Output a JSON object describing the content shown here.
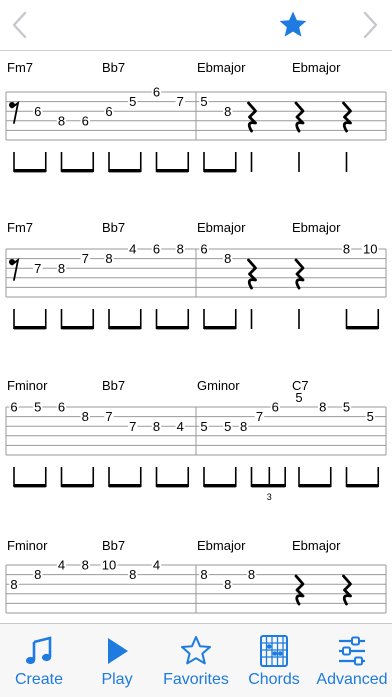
{
  "header": {
    "back_icon": "chevron-left-icon",
    "favorite_icon": "star-filled-icon",
    "forward_icon": "chevron-right-icon"
  },
  "colors": {
    "accent": "#1e7be0",
    "disabled": "#c7c7cc",
    "staff_line": "#9a9a9a"
  },
  "score": {
    "systems": [
      {
        "chords": [
          {
            "name": "Fm7",
            "beat": 0
          },
          {
            "name": "Bb7",
            "beat": 2
          },
          {
            "name": "Ebmajor",
            "beat": 4
          },
          {
            "name": "Ebmajor",
            "beat": 6
          }
        ],
        "notes": [
          {
            "beat": 0.5,
            "string": 2,
            "fret": "6"
          },
          {
            "beat": 1,
            "string": 3,
            "fret": "8"
          },
          {
            "beat": 1.5,
            "string": 3,
            "fret": "6"
          },
          {
            "beat": 2,
            "string": 2,
            "fret": "6"
          },
          {
            "beat": 2.5,
            "string": 1,
            "fret": "5"
          },
          {
            "beat": 3,
            "string": 0,
            "fret": "6"
          },
          {
            "beat": 3.5,
            "string": 1,
            "fret": "7"
          },
          {
            "beat": 4,
            "string": 1,
            "fret": "5"
          },
          {
            "beat": 4.5,
            "string": 2,
            "fret": "8"
          }
        ],
        "rests": [
          {
            "type": "eighth",
            "beat": 0
          },
          {
            "type": "quarter",
            "beat": 5
          },
          {
            "type": "quarter",
            "beat": 6
          },
          {
            "type": "quarter",
            "beat": 7
          }
        ],
        "rhythm": [
          {
            "type": "pair",
            "beat": 0
          },
          {
            "type": "pair",
            "beat": 1
          },
          {
            "type": "pair",
            "beat": 2
          },
          {
            "type": "pair",
            "beat": 3
          },
          {
            "type": "pair",
            "beat": 4
          },
          {
            "type": "single",
            "beat": 5
          },
          {
            "type": "single",
            "beat": 6
          },
          {
            "type": "single",
            "beat": 7
          }
        ]
      },
      {
        "chords": [
          {
            "name": "Fm7",
            "beat": 0
          },
          {
            "name": "Bb7",
            "beat": 2
          },
          {
            "name": "Ebmajor",
            "beat": 4
          },
          {
            "name": "Ebmajor",
            "beat": 6
          }
        ],
        "notes": [
          {
            "beat": 0.5,
            "string": 2,
            "fret": "7"
          },
          {
            "beat": 1,
            "string": 2,
            "fret": "8"
          },
          {
            "beat": 1.5,
            "string": 1,
            "fret": "7"
          },
          {
            "beat": 2,
            "string": 1,
            "fret": "8"
          },
          {
            "beat": 2.5,
            "string": 0,
            "fret": "4"
          },
          {
            "beat": 3,
            "string": 0,
            "fret": "6"
          },
          {
            "beat": 3.5,
            "string": 0,
            "fret": "8"
          },
          {
            "beat": 4,
            "string": 0,
            "fret": "6"
          },
          {
            "beat": 4.5,
            "string": 1,
            "fret": "8"
          },
          {
            "beat": 7,
            "string": 0,
            "fret": "8"
          },
          {
            "beat": 7.5,
            "string": 0,
            "fret": "10"
          }
        ],
        "rests": [
          {
            "type": "eighth",
            "beat": 0
          },
          {
            "type": "quarter",
            "beat": 5
          },
          {
            "type": "quarter",
            "beat": 6
          }
        ],
        "rhythm": [
          {
            "type": "pair",
            "beat": 0
          },
          {
            "type": "pair",
            "beat": 1
          },
          {
            "type": "pair",
            "beat": 2
          },
          {
            "type": "pair",
            "beat": 3
          },
          {
            "type": "pair",
            "beat": 4
          },
          {
            "type": "single",
            "beat": 5
          },
          {
            "type": "single",
            "beat": 6
          },
          {
            "type": "pair",
            "beat": 7
          }
        ]
      },
      {
        "chords": [
          {
            "name": "Fminor",
            "beat": 0
          },
          {
            "name": "Bb7",
            "beat": 2
          },
          {
            "name": "Gminor",
            "beat": 4
          },
          {
            "name": "C7",
            "beat": 6
          }
        ],
        "notes": [
          {
            "beat": 0,
            "string": 0,
            "fret": "6"
          },
          {
            "beat": 0.5,
            "string": 0,
            "fret": "5"
          },
          {
            "beat": 1,
            "string": 0,
            "fret": "6"
          },
          {
            "beat": 1.5,
            "string": 1,
            "fret": "8"
          },
          {
            "beat": 2,
            "string": 1,
            "fret": "7"
          },
          {
            "beat": 2.5,
            "string": 2,
            "fret": "7"
          },
          {
            "beat": 3,
            "string": 2,
            "fret": "8"
          },
          {
            "beat": 3.5,
            "string": 2,
            "fret": "4"
          },
          {
            "beat": 4,
            "string": 2,
            "fret": "5"
          },
          {
            "beat": 4.5,
            "string": 2,
            "fret": "5"
          },
          {
            "beat": 4.833,
            "string": 2,
            "fret": "8"
          },
          {
            "beat": 5.167,
            "string": 1,
            "fret": "7"
          },
          {
            "beat": 5.5,
            "string": 0,
            "fret": "6"
          },
          {
            "beat": 6,
            "string": -1,
            "fret": "5"
          },
          {
            "beat": 6.5,
            "string": 0,
            "fret": "8"
          },
          {
            "beat": 7,
            "string": 0,
            "fret": "5"
          },
          {
            "beat": 7.5,
            "string": 1,
            "fret": "5"
          }
        ],
        "rests": [],
        "rhythm": [
          {
            "type": "pair",
            "beat": 0
          },
          {
            "type": "pair",
            "beat": 1
          },
          {
            "type": "pair",
            "beat": 2
          },
          {
            "type": "pair",
            "beat": 3
          },
          {
            "type": "pair",
            "beat": 4
          },
          {
            "type": "triplet",
            "beat": 5,
            "label": "3"
          },
          {
            "type": "pair",
            "beat": 6
          },
          {
            "type": "pair",
            "beat": 7
          }
        ]
      },
      {
        "chords": [
          {
            "name": "Fminor",
            "beat": 0
          },
          {
            "name": "Bb7",
            "beat": 2
          },
          {
            "name": "Ebmajor",
            "beat": 4
          },
          {
            "name": "Ebmajor",
            "beat": 6
          }
        ],
        "notes": [
          {
            "beat": 0,
            "string": 2,
            "fret": "8"
          },
          {
            "beat": 0.5,
            "string": 1,
            "fret": "8"
          },
          {
            "beat": 1,
            "string": 0,
            "fret": "4"
          },
          {
            "beat": 1.5,
            "string": 0,
            "fret": "8"
          },
          {
            "beat": 2,
            "string": 0,
            "fret": "10"
          },
          {
            "beat": 2.5,
            "string": 1,
            "fret": "8"
          },
          {
            "beat": 3,
            "string": 0,
            "fret": "4"
          },
          {
            "beat": 4,
            "string": 1,
            "fret": "8"
          },
          {
            "beat": 4.5,
            "string": 2,
            "fret": "8"
          },
          {
            "beat": 5,
            "string": 1,
            "fret": "8"
          }
        ],
        "rests": [
          {
            "type": "quarter",
            "beat": 6
          },
          {
            "type": "quarter",
            "beat": 7
          }
        ],
        "rhythm": []
      }
    ]
  },
  "tabbar": {
    "items": [
      {
        "label": "Create",
        "icon": "music-note-icon"
      },
      {
        "label": "Play",
        "icon": "play-icon"
      },
      {
        "label": "Favorites",
        "icon": "star-outline-icon"
      },
      {
        "label": "Chords",
        "icon": "chord-chart-icon"
      },
      {
        "label": "Advanced",
        "icon": "sliders-icon"
      }
    ]
  }
}
